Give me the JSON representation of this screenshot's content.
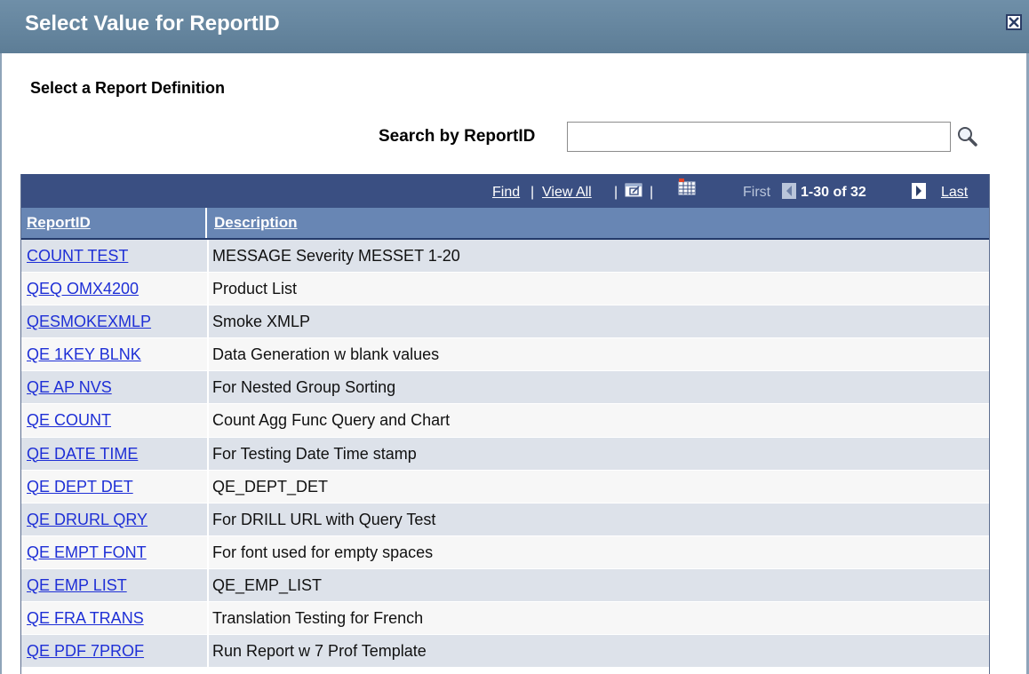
{
  "dialog": {
    "title": "Select Value for ReportID"
  },
  "heading": "Select a Report Definition",
  "search": {
    "label": "Search by ReportID",
    "value": "",
    "button_icon": "magnifier-icon"
  },
  "grid_nav": {
    "find": "Find",
    "view_all": "View All",
    "separator": "|",
    "first": "First",
    "count": "1-30 of 32",
    "last": "Last",
    "zoom_icon": "new-window-icon",
    "download_icon": "download-spreadsheet-icon",
    "prev_icon": "previous-page-icon",
    "next_icon": "next-page-icon"
  },
  "columns": {
    "id": "ReportID",
    "desc": "Description"
  },
  "rows": [
    {
      "id": "COUNT TEST",
      "desc": "MESSAGE Severity MESSET 1-20"
    },
    {
      "id": "QEQ OMX4200",
      "desc": "Product List"
    },
    {
      "id": "QESMOKEXMLP",
      "desc": "Smoke XMLP"
    },
    {
      "id": "QE 1KEY BLNK",
      "desc": "Data Generation w blank values"
    },
    {
      "id": "QE AP NVS",
      "desc": "For Nested Group Sorting"
    },
    {
      "id": "QE COUNT",
      "desc": "Count Agg Func Query and Chart"
    },
    {
      "id": "QE DATE TIME",
      "desc": "For Testing Date Time stamp"
    },
    {
      "id": "QE DEPT DET",
      "desc": "QE_DEPT_DET"
    },
    {
      "id": "QE DRURL QRY",
      "desc": "For DRILL URL with Query Test"
    },
    {
      "id": "QE EMPT FONT",
      "desc": "For font used for empty spaces"
    },
    {
      "id": "QE EMP LIST",
      "desc": "QE_EMP_LIST"
    },
    {
      "id": "QE FRA TRANS",
      "desc": "Translation Testing for French"
    },
    {
      "id": "QE PDF 7PROF",
      "desc": "Run Report w 7 Prof Template"
    }
  ],
  "colors": {
    "titlebar": "#6f8fa8",
    "grid_nav": "#3a4f82",
    "column_header": "#6886b4",
    "row_odd": "#dde2ea",
    "row_even": "#f7f7f7",
    "link": "#1e2fd6"
  }
}
